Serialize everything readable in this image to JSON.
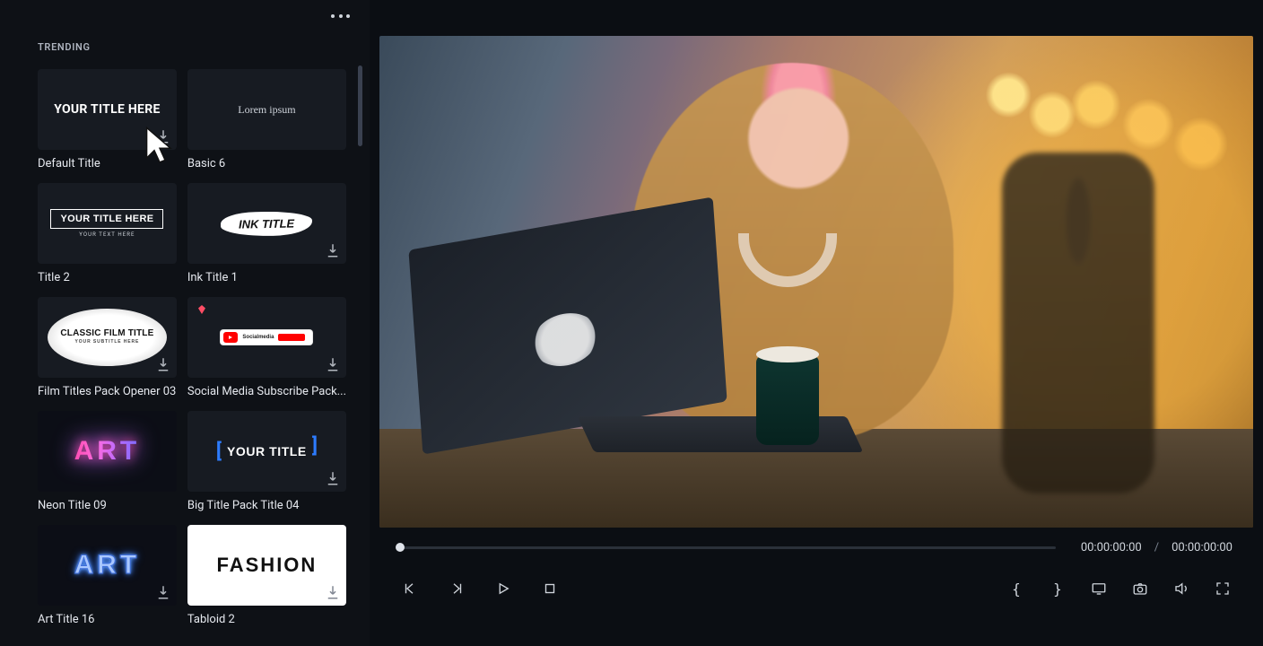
{
  "section_header": "TRENDING",
  "titles": [
    {
      "label": "Default Title",
      "preview": "YOUR TITLE HERE",
      "download_icon": true
    },
    {
      "label": "Basic 6",
      "preview": "Lorem ipsum",
      "download_icon": false
    },
    {
      "label": "Title 2",
      "preview": "YOUR TITLE HERE",
      "sub": "YOUR TEXT HERE",
      "download_icon": false
    },
    {
      "label": "Ink Title 1",
      "preview": "INK TITLE",
      "download_icon": true
    },
    {
      "label": "Film Titles Pack Opener 03",
      "preview": "CLASSIC FILM TITLE",
      "sub": "YOUR SUBTITLE HERE",
      "download_icon": true
    },
    {
      "label": "Social Media Subscribe Pack...",
      "preview": "Socialmedia",
      "download_icon": true,
      "premium": true
    },
    {
      "label": "Neon Title 09",
      "preview": "ART",
      "download_icon": false
    },
    {
      "label": "Big Title Pack Title 04",
      "preview": "YOUR TITLE",
      "download_icon": true
    },
    {
      "label": "Art Title 16",
      "preview": "ART",
      "download_icon": true
    },
    {
      "label": "Tabloid 2",
      "preview": "FASHION",
      "download_icon": true
    }
  ],
  "timecode": {
    "current": "00:00:00:00",
    "separator": "/",
    "total": "00:00:00:00"
  },
  "controls": {
    "prev_frame": "previous-frame",
    "next_frame": "next-frame",
    "play": "play",
    "stop": "stop",
    "mark_in": "{",
    "mark_out": "}",
    "export_frame": "export-frame",
    "snapshot": "snapshot",
    "volume": "volume",
    "fullscreen": "fullscreen"
  }
}
